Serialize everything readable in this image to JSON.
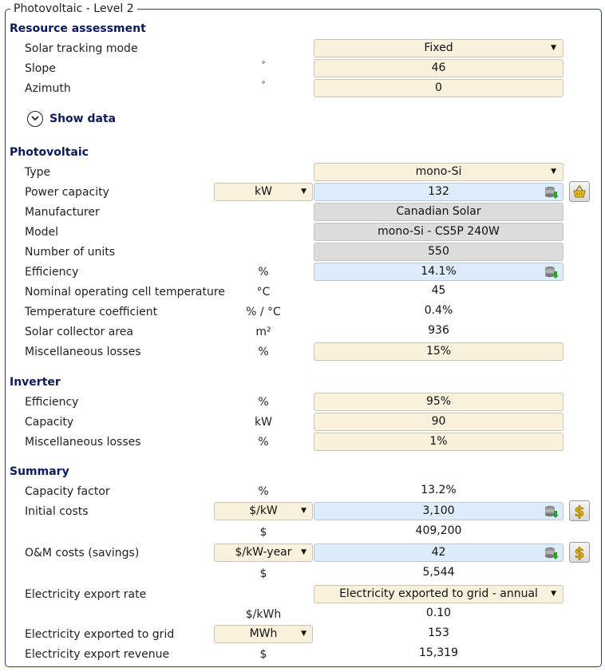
{
  "window_title": "Photovoltaic - Level 2",
  "sections": {
    "resource": "Resource assessment",
    "photovoltaic": "Photovoltaic",
    "inverter": "Inverter",
    "summary": "Summary"
  },
  "resource": {
    "tracking_label": "Solar tracking mode",
    "tracking_value": "Fixed",
    "slope_label": "Slope",
    "slope_unit": "°",
    "slope_value": "46",
    "azimuth_label": "Azimuth",
    "azimuth_unit": "°",
    "azimuth_value": "0",
    "show_data": "Show data"
  },
  "pv": {
    "type_label": "Type",
    "type_value": "mono-Si",
    "power_label": "Power capacity",
    "power_unit": "kW",
    "power_value": "132",
    "manufacturer_label": "Manufacturer",
    "manufacturer_value": "Canadian Solar",
    "model_label": "Model",
    "model_value": "mono-Si - CS5P 240W",
    "units_label": "Number of units",
    "units_value": "550",
    "efficiency_label": "Efficiency",
    "efficiency_unit": "%",
    "efficiency_value": "14.1%",
    "noct_label": "Nominal operating cell temperature",
    "noct_unit": "°C",
    "noct_value": "45",
    "tempcoef_label": "Temperature coefficient",
    "tempcoef_unit": "% / °C",
    "tempcoef_value": "0.4%",
    "area_label": "Solar collector area",
    "area_unit": "m²",
    "area_value": "936",
    "misc_label": "Miscellaneous losses",
    "misc_unit": "%",
    "misc_value": "15%"
  },
  "inverter": {
    "efficiency_label": "Efficiency",
    "efficiency_unit": "%",
    "efficiency_value": "95%",
    "capacity_label": "Capacity",
    "capacity_unit": "kW",
    "capacity_value": "90",
    "misc_label": "Miscellaneous losses",
    "misc_unit": "%",
    "misc_value": "1%"
  },
  "summary": {
    "capfactor_label": "Capacity factor",
    "capfactor_unit": "%",
    "capfactor_value": "13.2%",
    "initial_label": "Initial costs",
    "initial_unit": "$/kW",
    "initial_value": "3,100",
    "initial_total_unit": "$",
    "initial_total_value": "409,200",
    "om_label": "O&M costs (savings)",
    "om_unit": "$/kW-year",
    "om_value": "42",
    "om_total_unit": "$",
    "om_total_value": "5,544",
    "export_rate_label": "Electricity export rate",
    "export_rate_value": "Electricity exported to grid - annual",
    "export_rate_unit": "$/kWh",
    "export_rate_amount": "0.10",
    "exported_label": "Electricity exported to grid",
    "exported_unit": "MWh",
    "exported_value": "153",
    "revenue_label": "Electricity export revenue",
    "revenue_unit": "$",
    "revenue_value": "15,319"
  },
  "colors": {
    "frame": "#2a3a7a",
    "section_heading": "#0c1a5e",
    "editable_field": "#faf1dc",
    "linked_field": "#ddecfb",
    "readonly_field": "#dcdcdc"
  },
  "icons": {
    "dropdown": "triangle-down",
    "database": "database-icon",
    "product_database": "basket-icon",
    "cost_database": "dollar-icon",
    "expand": "chevron-down-icon"
  }
}
